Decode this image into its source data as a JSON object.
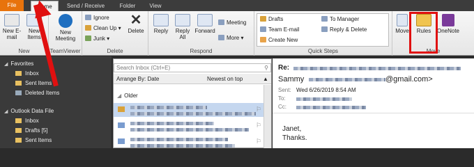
{
  "tabs": {
    "file": "File",
    "home": "Home",
    "send_receive": "Send / Receive",
    "folder": "Folder",
    "view": "View"
  },
  "ribbon": {
    "new_group": {
      "new_email": "New E-mail",
      "new_items": "New Items",
      "label": "New"
    },
    "teamviewer_group": {
      "new_meeting": "New Meeting",
      "label": "TeamViewer"
    },
    "delete_group": {
      "ignore": "Ignore",
      "clean_up": "Clean Up",
      "junk": "Junk",
      "delete": "Delete",
      "label": "Delete"
    },
    "respond_group": {
      "reply": "Reply",
      "reply_all": "Reply All",
      "forward": "Forward",
      "meeting": "Meeting",
      "more": "More",
      "label": "Respond"
    },
    "quick_steps": {
      "drafts": "Drafts",
      "team_email": "Team E-mail",
      "create_new": "Create New",
      "to_manager": "To Manager",
      "reply_delete": "Reply & Delete",
      "label": "Quick Steps"
    },
    "move_group": {
      "move": "Move",
      "rules": "Rules",
      "onenote": "OneNote",
      "label": "Move"
    }
  },
  "nav": {
    "favorites": "Favorites",
    "inbox": "Inbox",
    "sent_items": "Sent Items",
    "deleted_items": "Deleted Items",
    "data_file": "Outlook Data File",
    "inbox2": "Inbox",
    "drafts": "Drafts [5]",
    "sent_items2": "Sent Items"
  },
  "list": {
    "search_placeholder": "Search Inbox (Ctrl+E)",
    "arrange_by": "Arrange By: Date",
    "sort": "Newest on top",
    "group_older": "Older"
  },
  "reading": {
    "subject_prefix": "Re:",
    "sender_name": "Sammy",
    "sender_domain": "@gmail.com>",
    "sent_label": "Sent:",
    "sent_value": "Wed 6/26/2019 8:54 AM",
    "to_label": "To:",
    "cc_label": "Cc:",
    "body_line1": "Janet,",
    "body_line2": "Thanks."
  },
  "colors": {
    "file_tab": "#e8730c",
    "highlight": "#e01010",
    "selected_row": "#c5d7ef"
  }
}
